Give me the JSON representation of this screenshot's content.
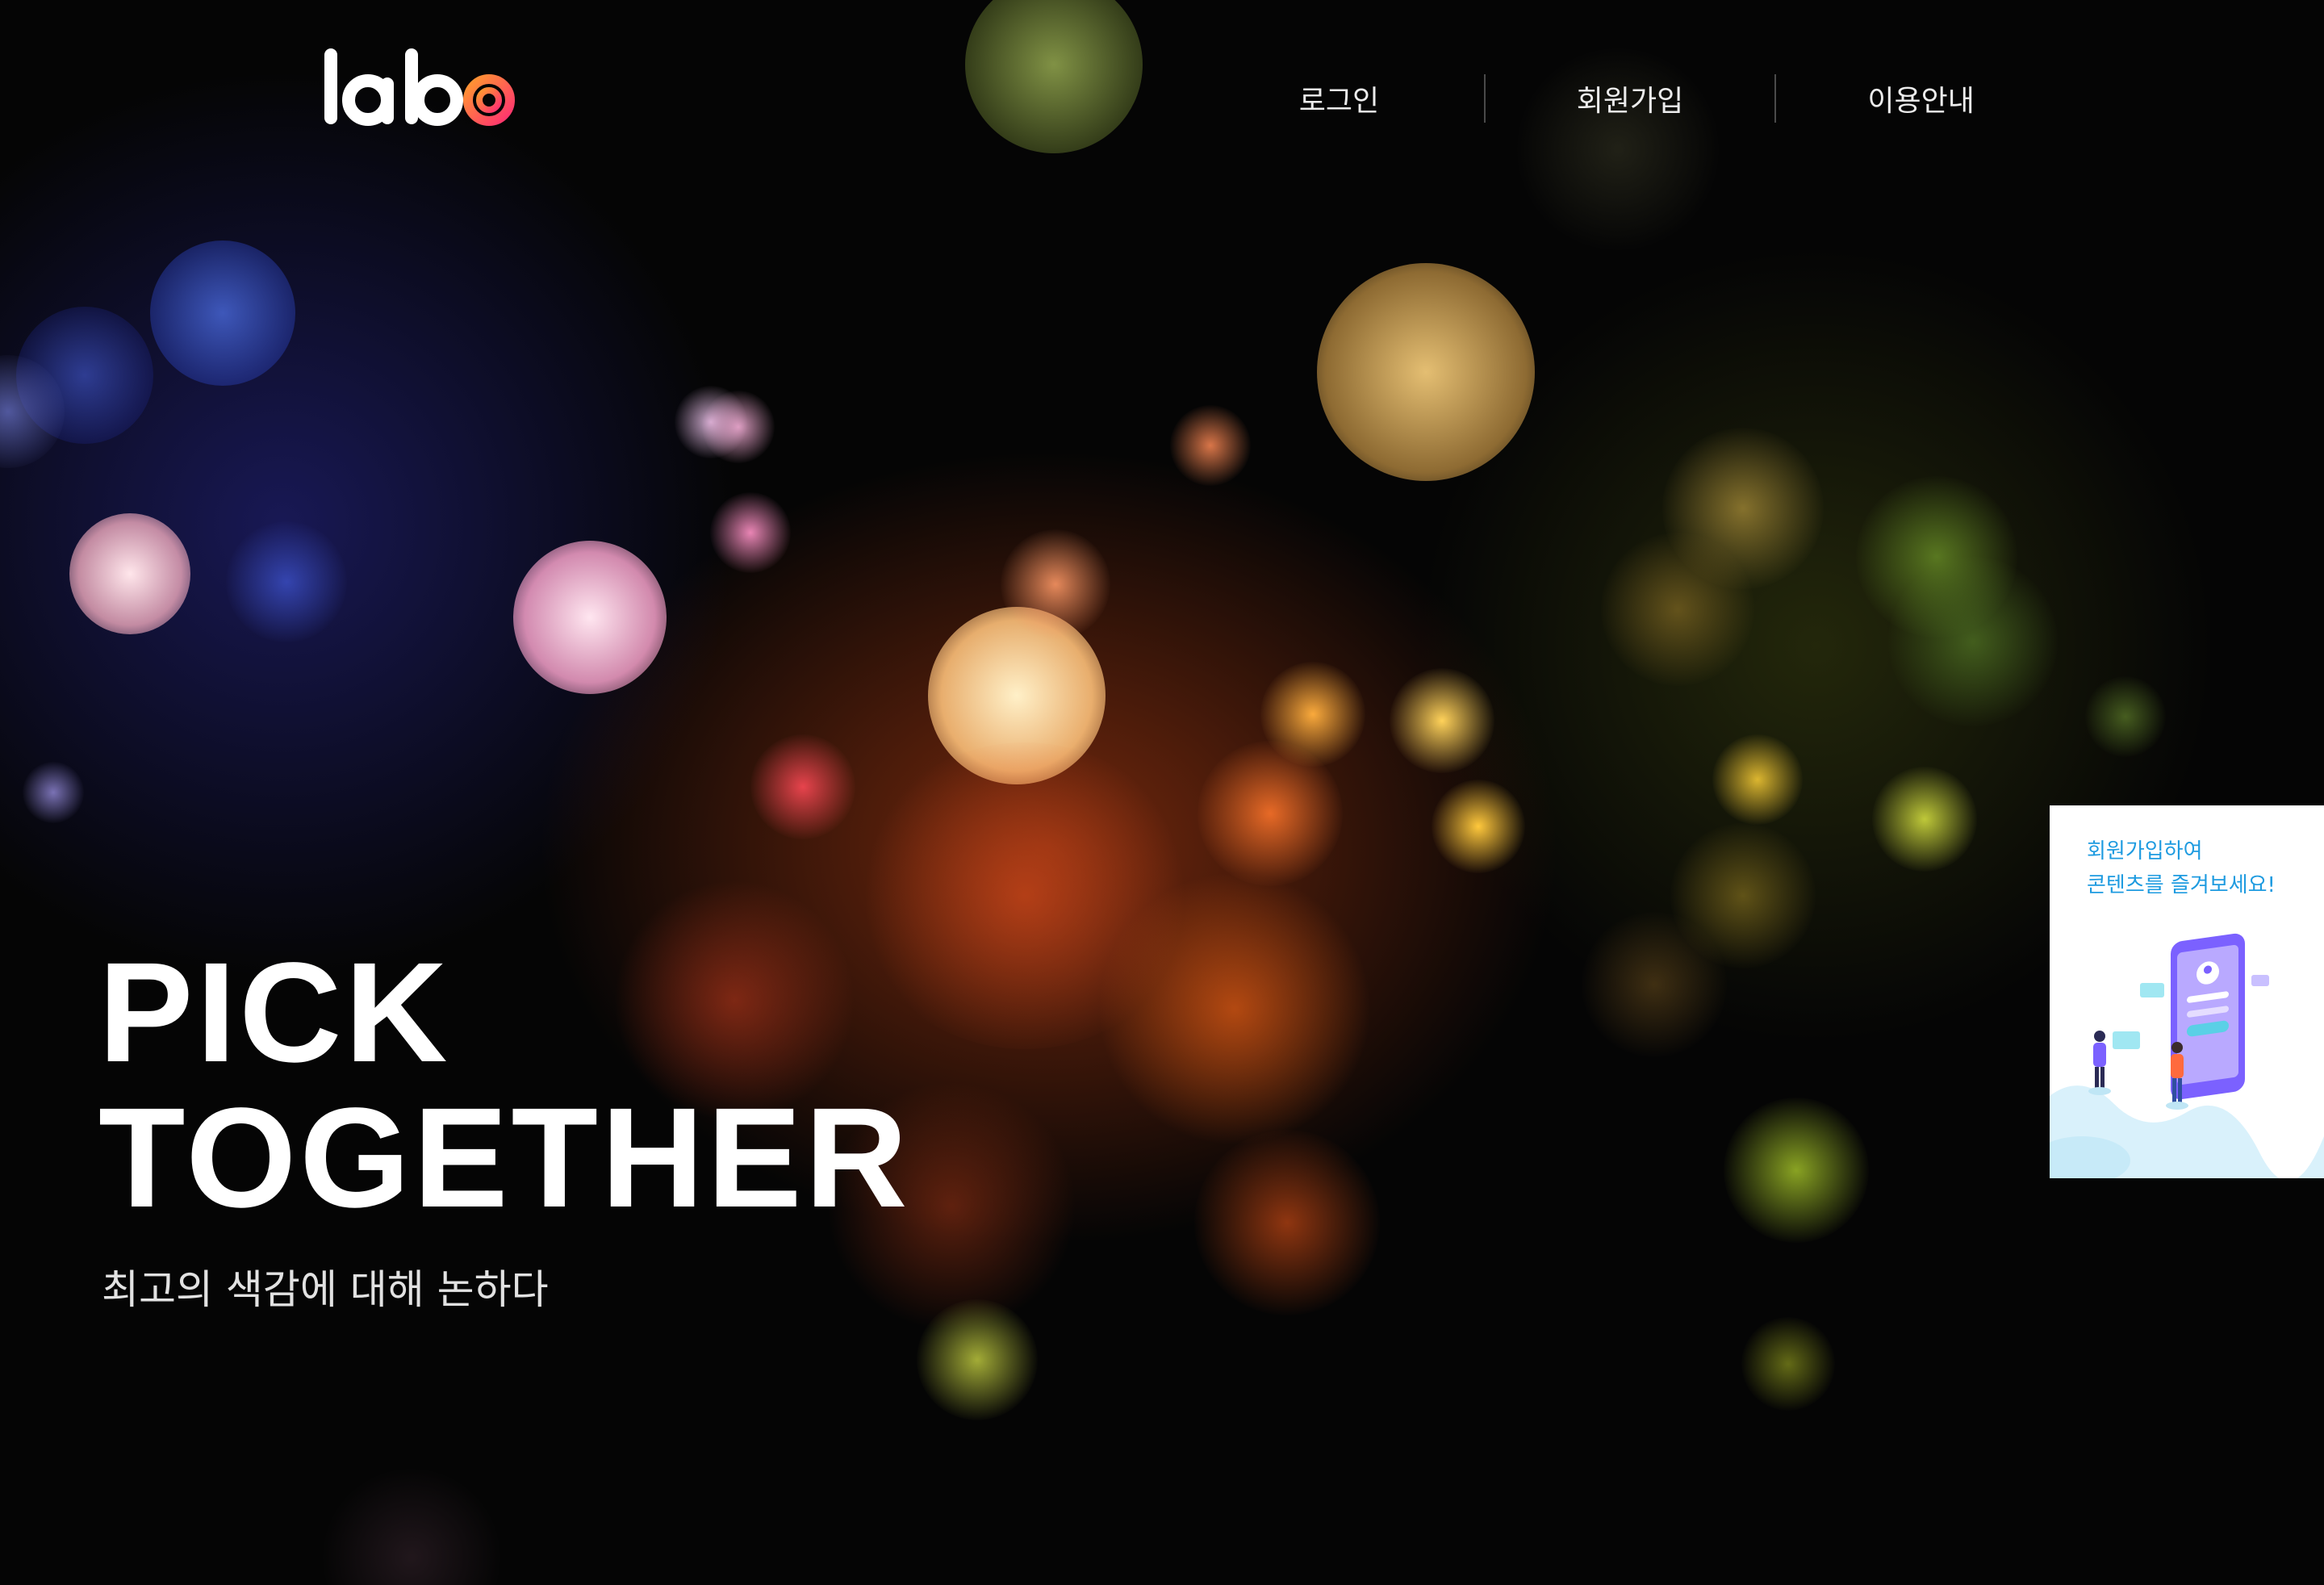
{
  "header": {
    "logo_text": "lab",
    "logo_mark": "labo-o-ring-logo",
    "nav": [
      {
        "label": "로그인"
      },
      {
        "label": "회원가입"
      },
      {
        "label": "이용안내"
      }
    ]
  },
  "hero": {
    "headline_line1": "PICK",
    "headline_line2": "TOGETHER",
    "subheadline": "최고의 색감에 대해 논하다",
    "background": "colorful-bokeh-lights"
  },
  "promo_banner": {
    "line1": "회원가입하여",
    "line2": "콘텐츠를 즐겨보세요!",
    "illustration": "signup-phone-people-illustration"
  },
  "colors": {
    "promo_text": "#1e9be0",
    "logo_gradient_start": "#ff3c6e",
    "logo_gradient_end": "#ff9a2e",
    "illustration_purple": "#7b61ff"
  }
}
